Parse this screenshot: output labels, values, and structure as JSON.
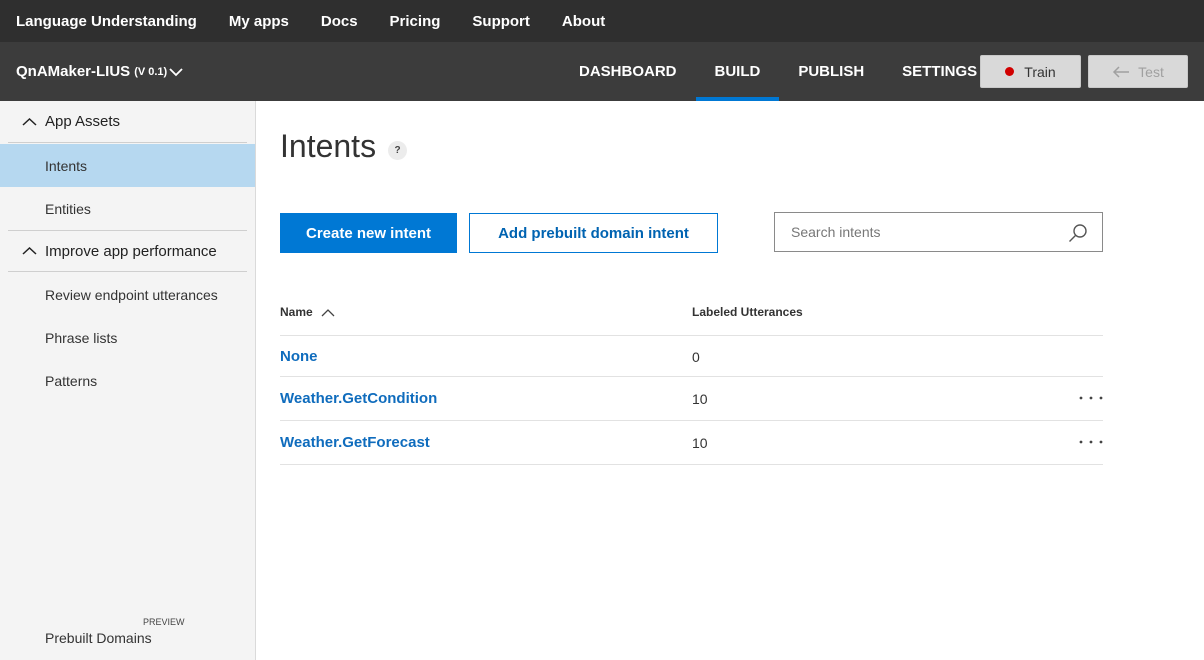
{
  "topnav": {
    "items": [
      "Language Understanding",
      "My apps",
      "Docs",
      "Pricing",
      "Support",
      "About"
    ]
  },
  "appbar": {
    "app_name": "QnAMaker-LIUS",
    "version": "(V 0.1)",
    "tabs": [
      {
        "label": "DASHBOARD",
        "active": false
      },
      {
        "label": "BUILD",
        "active": true
      },
      {
        "label": "PUBLISH",
        "active": false
      },
      {
        "label": "SETTINGS",
        "active": false
      }
    ],
    "train_label": "Train",
    "test_label": "Test",
    "accent_color": "#0078d4",
    "train_dot_color": "#d10000"
  },
  "sidebar": {
    "section_app_assets": "App Assets",
    "section_improve": "Improve app performance",
    "items": [
      "Intents",
      "Entities",
      "Review endpoint utterances",
      "Phrase lists",
      "Patterns"
    ],
    "active_item": "Intents",
    "prebuilt_domains": "Prebuilt Domains",
    "preview_badge": "PREVIEW"
  },
  "main": {
    "title": "Intents",
    "help_label": "?",
    "create_button": "Create new intent",
    "prebuilt_button": "Add prebuilt domain intent",
    "search_placeholder": "Search intents",
    "table": {
      "headers": [
        "Name",
        "Labeled Utterances"
      ],
      "rows": [
        {
          "name": "None",
          "count": "0",
          "has_menu": false
        },
        {
          "name": "Weather.GetCondition",
          "count": "10",
          "has_menu": true
        },
        {
          "name": "Weather.GetForecast",
          "count": "10",
          "has_menu": true
        }
      ]
    }
  }
}
